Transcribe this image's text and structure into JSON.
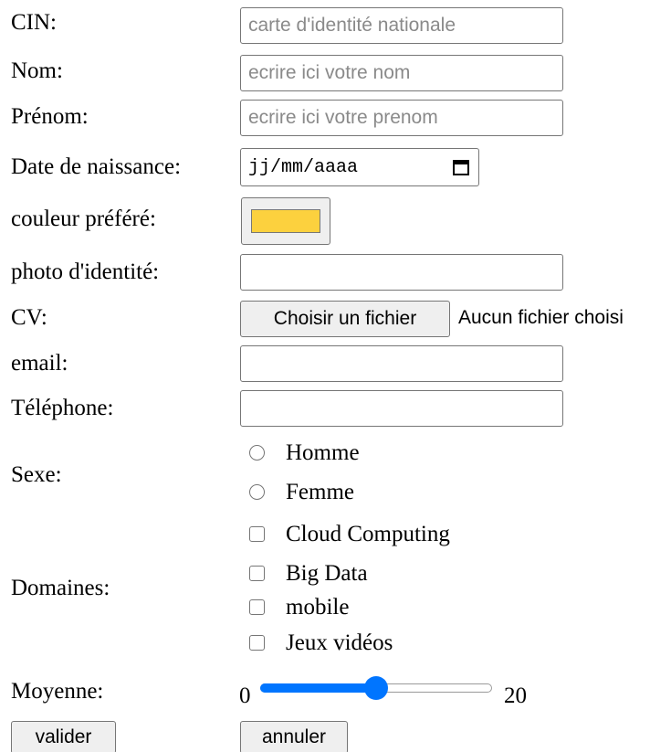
{
  "form": {
    "cin": {
      "label": "CIN:",
      "placeholder": "carte d'identité nationale"
    },
    "nom": {
      "label": "Nom:",
      "placeholder": "ecrire ici votre nom"
    },
    "prenom": {
      "label": "Prénom:",
      "placeholder": "ecrire ici votre prenom"
    },
    "naissance": {
      "label": "Date de naissance:",
      "value": "jj/mm/aaaa",
      "icon": "calendar-icon"
    },
    "couleur": {
      "label": "couleur préféré:",
      "value": "#FCD13E"
    },
    "photo": {
      "label": "photo d'identité:",
      "value": ""
    },
    "cv": {
      "label": "CV:",
      "button": "Choisir un fichier",
      "status": "Aucun fichier choisi"
    },
    "email": {
      "label": "email:",
      "value": ""
    },
    "telephone": {
      "label": "Téléphone:",
      "value": ""
    },
    "sexe": {
      "label": "Sexe:",
      "options": [
        "Homme",
        "Femme"
      ],
      "selected": null
    },
    "domaines": {
      "label": "Domaines:",
      "options": [
        "Cloud Computing",
        "Big Data",
        "mobile",
        "Jeux vidéos"
      ],
      "checked": []
    },
    "moyenne": {
      "label": "Moyenne:",
      "min_label": "0",
      "max_label": "20",
      "min": 0,
      "max": 20,
      "value": 10,
      "accent": "#0075FF"
    }
  },
  "actions": {
    "submit": "valider",
    "reset": "annuler"
  }
}
